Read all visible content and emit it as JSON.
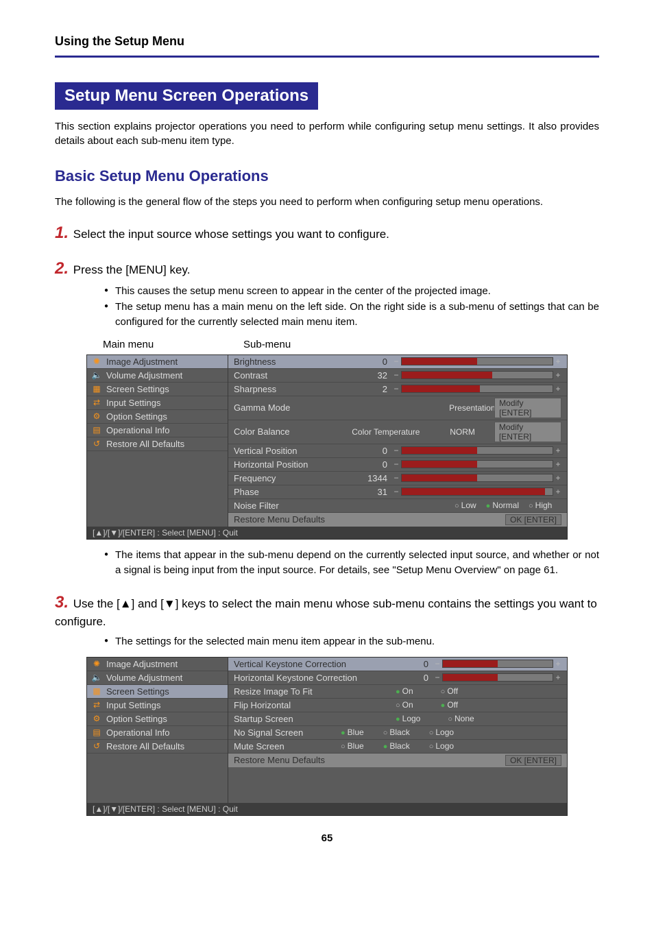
{
  "runningHead": "Using the Setup Menu",
  "sectionHeading": "Setup Menu Screen Operations",
  "introText": "This section explains projector operations you need to perform while configuring setup menu settings. It also provides details about each sub-menu item type.",
  "subHeading": "Basic Setup Menu Operations",
  "subIntro": "The following is the general flow of the steps you need to perform when configuring setup menu operations.",
  "step1": {
    "num": "1.",
    "text": "Select the input source whose settings you want to configure."
  },
  "step2": {
    "num": "2.",
    "text": "Press the [MENU] key.",
    "bullets": [
      "This causes the setup menu screen to appear in the center of the projected image.",
      "The setup menu has a main menu on the left side. On the right side is a sub-menu of settings that can be configured for the currently selected main menu item."
    ]
  },
  "labels": {
    "main": "Main menu",
    "sub": "Sub-menu"
  },
  "mainMenu": [
    {
      "icon": "✺",
      "label": "Image Adjustment"
    },
    {
      "icon": "🔈",
      "label": "Volume Adjustment"
    },
    {
      "icon": "▦",
      "label": "Screen Settings"
    },
    {
      "icon": "⇄",
      "label": "Input Settings"
    },
    {
      "icon": "⚙",
      "label": "Option Settings"
    },
    {
      "icon": "▤",
      "label": "Operational Info"
    },
    {
      "icon": "↺",
      "label": "Restore All Defaults"
    }
  ],
  "shot1": {
    "rows": [
      {
        "name": "Brightness",
        "val": "0",
        "fill": 50
      },
      {
        "name": "Contrast",
        "val": "32",
        "fill": 60
      },
      {
        "name": "Sharpness",
        "val": "2",
        "fill": 52
      },
      {
        "name": "Gamma Mode",
        "extra": "",
        "tag": "Presentation",
        "btn": "Modify [ENTER]"
      },
      {
        "name": "Color Balance",
        "extra": "Color Temperature",
        "tag": "NORM",
        "btn": "Modify [ENTER]"
      },
      {
        "name": "Vertical Position",
        "val": "0",
        "fill": 50
      },
      {
        "name": "Horizontal Position",
        "val": "0",
        "fill": 50
      },
      {
        "name": "Frequency",
        "val": "1344",
        "fill": 50
      },
      {
        "name": "Phase",
        "val": "31",
        "fill": 95
      },
      {
        "name": "Noise Filter",
        "opts": [
          {
            "t": "Low",
            "on": false
          },
          {
            "t": "Normal",
            "on": true
          },
          {
            "t": "High",
            "on": false
          }
        ]
      }
    ],
    "restore": "Restore Menu Defaults",
    "restoreBtn": "OK [ENTER]",
    "footer": "[▲]/[▼]/[ENTER] : Select    [MENU] : Quit",
    "selMain": 0
  },
  "afterShot1Bullet": "The items that appear in the sub-menu depend on the currently selected input source, and whether or not a signal is being input from the input source. For details, see \"Setup Menu Overview\" on page 61.",
  "step3": {
    "num": "3.",
    "text": "Use the [▲] and [▼] keys to select the main menu whose sub-menu contains the settings you want to configure.",
    "bullet": "The settings for the selected main menu item appear in the sub-menu."
  },
  "shot2": {
    "rows": [
      {
        "name": "Vertical Keystone Correction",
        "val": "0",
        "fill": 50
      },
      {
        "name": "Horizontal Keystone Correction",
        "val": "0",
        "fill": 50
      },
      {
        "name": "Resize Image To Fit",
        "opts": [
          {
            "t": "On",
            "on": true
          },
          {
            "t": "Off",
            "on": false
          }
        ]
      },
      {
        "name": "Flip Horizontal",
        "opts": [
          {
            "t": "On",
            "on": false
          },
          {
            "t": "Off",
            "on": true
          }
        ]
      },
      {
        "name": "Startup Screen",
        "opts": [
          {
            "t": "Logo",
            "on": true
          },
          {
            "t": "None",
            "on": false
          }
        ]
      },
      {
        "name": "No Signal Screen",
        "opts3": [
          {
            "t": "Blue",
            "on": true
          },
          {
            "t": "Black",
            "on": false
          },
          {
            "t": "Logo",
            "on": false
          }
        ]
      },
      {
        "name": "Mute Screen",
        "opts3": [
          {
            "t": "Blue",
            "on": false
          },
          {
            "t": "Black",
            "on": true
          },
          {
            "t": "Logo",
            "on": false
          }
        ]
      }
    ],
    "restore": "Restore Menu Defaults",
    "restoreBtn": "OK [ENTER]",
    "footer": "[▲]/[▼]/[ENTER] : Select    [MENU] : Quit",
    "selMain": 2
  },
  "pageNum": "65"
}
